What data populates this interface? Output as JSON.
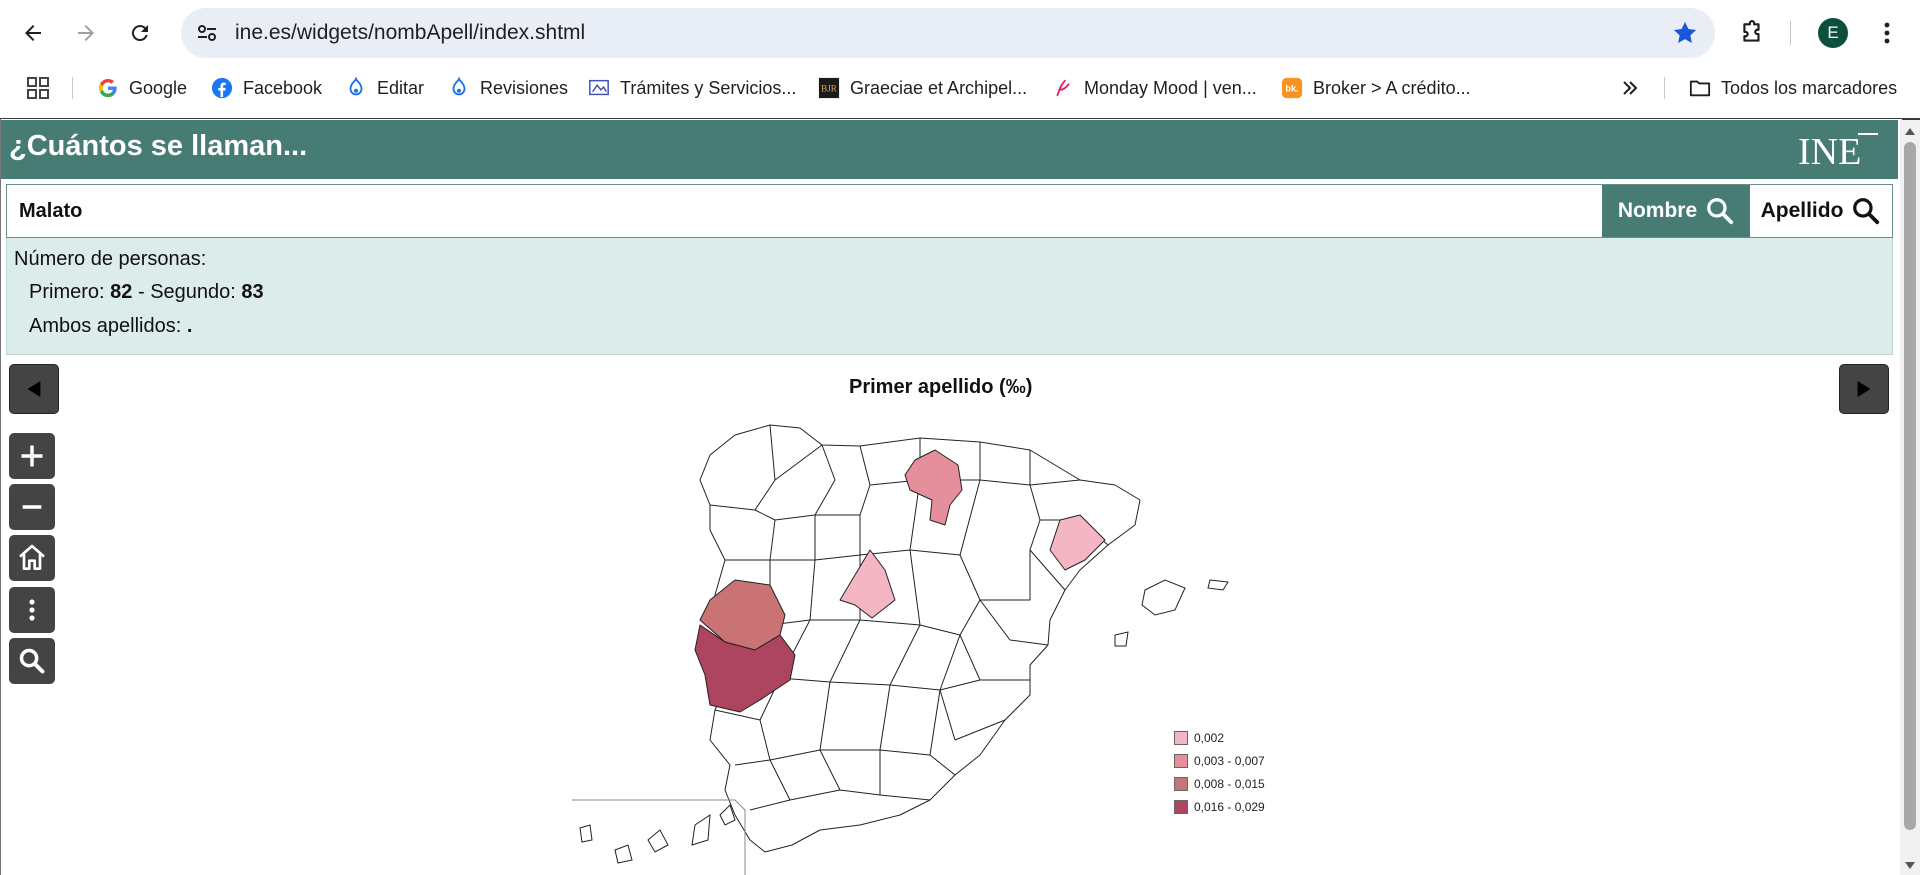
{
  "browser": {
    "url": "ine.es/widgets/nombApell/index.shtml",
    "avatar_letter": "E",
    "bookmarks": [
      {
        "label": "Google",
        "icon": "google-icon"
      },
      {
        "label": "Facebook",
        "icon": "facebook-icon"
      },
      {
        "label": "Editar",
        "icon": "drupal-icon"
      },
      {
        "label": "Revisiones",
        "icon": "drupal-icon"
      },
      {
        "label": "Trámites y Servicios...",
        "icon": "tramites-icon"
      },
      {
        "label": "Graeciae et Archipel...",
        "icon": "bjr-icon"
      },
      {
        "label": "Monday Mood | ven...",
        "icon": "monday-icon"
      },
      {
        "label": "Broker > A crédito...",
        "icon": "broker-icon"
      }
    ],
    "all_bookmarks_label": "Todos los marcadores"
  },
  "widget": {
    "title": "¿Cuántos se llaman...",
    "logo_text": "INE",
    "search_value": "Malato",
    "btn_nombre": "Nombre",
    "btn_apellido": "Apellido",
    "results": {
      "heading": "Número de personas:",
      "primero_label": "Primero:",
      "primero_value": "82",
      "separator": "-",
      "segundo_label": "Segundo:",
      "segundo_value": "83",
      "ambos_label": "Ambos apellidos:",
      "ambos_value": "."
    },
    "map_title": "Primer apellido (‰)",
    "legend": [
      {
        "label": "0,002",
        "color": "#f4b6c2"
      },
      {
        "label": "0,003 - 0,007",
        "color": "#e68f9c"
      },
      {
        "label": "0,008 - 0,015",
        "color": "#c97374"
      },
      {
        "label": "0,016 - 0,029",
        "color": "#ad4460"
      }
    ]
  },
  "colors": {
    "header": "#467c73",
    "results_bg": "#dcecea",
    "accent_star": "#1a56db"
  }
}
